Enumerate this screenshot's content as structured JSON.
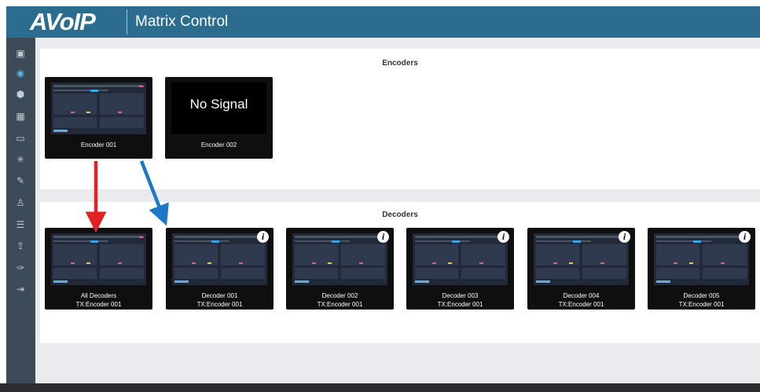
{
  "header": {
    "logo": "AVoIP",
    "title": "Matrix Control"
  },
  "sidebar": {
    "items": [
      {
        "name": "sidebar-item-dashboard",
        "icon": "dashboard-icon",
        "glyph": "▣"
      },
      {
        "name": "sidebar-item-matrix",
        "icon": "matrix-icon",
        "glyph": "◉",
        "active": true
      },
      {
        "name": "sidebar-item-devices",
        "icon": "devices-icon",
        "glyph": "⬢"
      },
      {
        "name": "sidebar-item-videowall",
        "icon": "videowall-icon",
        "glyph": "▦"
      },
      {
        "name": "sidebar-item-display",
        "icon": "monitor-icon",
        "glyph": "▭"
      },
      {
        "name": "sidebar-item-network",
        "icon": "network-icon",
        "glyph": "✳"
      },
      {
        "name": "sidebar-item-tools",
        "icon": "pen-icon",
        "glyph": "✎"
      },
      {
        "name": "sidebar-item-users",
        "icon": "user-icon",
        "glyph": "♙"
      },
      {
        "name": "sidebar-item-settings",
        "icon": "sliders-icon",
        "glyph": "☰"
      },
      {
        "name": "sidebar-item-upgrade",
        "icon": "upload-icon",
        "glyph": "⇪"
      },
      {
        "name": "sidebar-item-maintenance",
        "icon": "wrench-icon",
        "glyph": "✑"
      },
      {
        "name": "sidebar-item-logout",
        "icon": "logout-icon",
        "glyph": "⇥"
      }
    ]
  },
  "encoders": {
    "title": "Encoders",
    "tiles": [
      {
        "name": "Encoder 001",
        "signal": true
      },
      {
        "name": "Encoder 002",
        "signal": false,
        "no_signal_text": "No Signal"
      }
    ]
  },
  "decoders": {
    "title": "Decoders",
    "tiles": [
      {
        "name": "All Decoders",
        "source": "TX:Encoder 001",
        "info": false
      },
      {
        "name": "Decoder 001",
        "source": "TX:Encoder 001",
        "info": true
      },
      {
        "name": "Decoder 002",
        "source": "TX:Encoder 001",
        "info": true
      },
      {
        "name": "Decoder 003",
        "source": "TX:Encoder 001",
        "info": true
      },
      {
        "name": "Decoder 004",
        "source": "TX:Encoder 001",
        "info": true
      },
      {
        "name": "Decoder 005",
        "source": "TX:Encoder 001",
        "info": true
      }
    ]
  },
  "annotations": {
    "red_arrow_color": "#e12222",
    "blue_arrow_color": "#1e78c8"
  },
  "colors": {
    "header": "#2c6d8f",
    "sidebar": "#3d4a57",
    "content_bg": "#e9ebee"
  }
}
